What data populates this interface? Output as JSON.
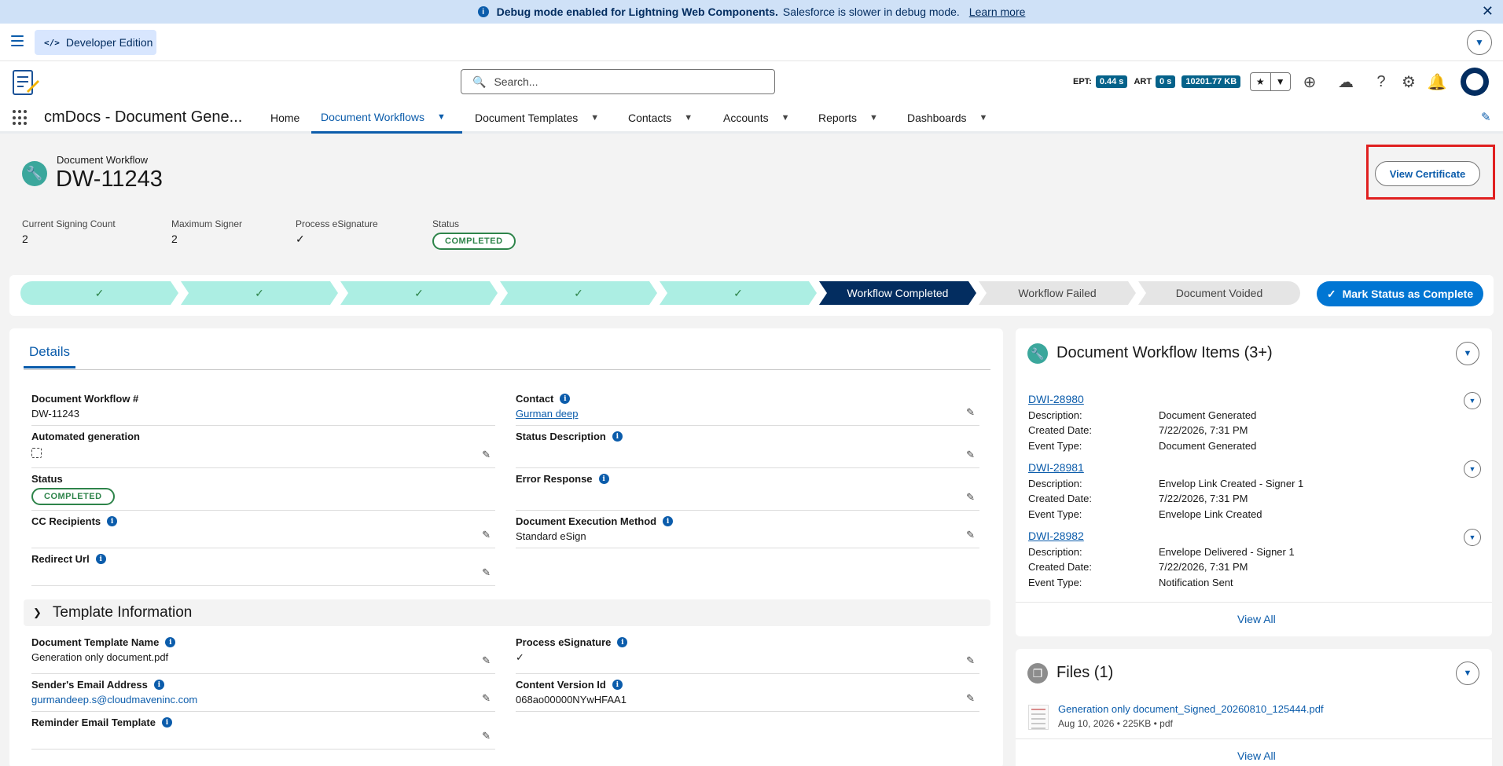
{
  "debug_banner": {
    "bold_text": "Debug mode enabled for Lightning Web Components.",
    "text": "Salesforce is slower in debug mode.",
    "link": "Learn more"
  },
  "utility": {
    "edition": "Developer Edition"
  },
  "header": {
    "search_placeholder": "Search...",
    "metrics": [
      {
        "label": "EPT:",
        "value": "0.44 s"
      },
      {
        "label": "ART",
        "value": "0 s"
      },
      {
        "label": "",
        "value": "10201.77 KB"
      }
    ]
  },
  "nav": {
    "app_name": "cmDocs - Document Gene...",
    "items": [
      {
        "label": "Home",
        "has_menu": false
      },
      {
        "label": "Document Workflows",
        "has_menu": true,
        "active": true
      },
      {
        "label": "Document Templates",
        "has_menu": true
      },
      {
        "label": "Contacts",
        "has_menu": true
      },
      {
        "label": "Accounts",
        "has_menu": true
      },
      {
        "label": "Reports",
        "has_menu": true
      },
      {
        "label": "Dashboards",
        "has_menu": true
      }
    ]
  },
  "record": {
    "object_type": "Document Workflow",
    "name": "DW-11243",
    "action_button": "View Certificate",
    "highlights": [
      {
        "label": "Current Signing Count",
        "value": "2"
      },
      {
        "label": "Maximum Signer",
        "value": "2"
      },
      {
        "label": "Process eSignature",
        "value": "✓"
      },
      {
        "label": "Status",
        "value": "COMPLETED"
      }
    ]
  },
  "path": {
    "stages": [
      {
        "label": "✓",
        "state": "done"
      },
      {
        "label": "✓",
        "state": "done"
      },
      {
        "label": "✓",
        "state": "done"
      },
      {
        "label": "✓",
        "state": "done"
      },
      {
        "label": "✓",
        "state": "done"
      },
      {
        "label": "Workflow Completed",
        "state": "current"
      },
      {
        "label": "Workflow Failed",
        "state": "future"
      },
      {
        "label": "Document Voided",
        "state": "future"
      }
    ],
    "mark_button": "Mark Status as Complete"
  },
  "details": {
    "tab_label": "Details",
    "fields": {
      "dw_number": {
        "label": "Document Workflow #",
        "value": "DW-11243"
      },
      "contact": {
        "label": "Contact",
        "value": "Gurman deep"
      },
      "automated_generation": {
        "label": "Automated generation",
        "value": ""
      },
      "status_description": {
        "label": "Status Description",
        "value": ""
      },
      "status": {
        "label": "Status",
        "value": "COMPLETED"
      },
      "error_response": {
        "label": "Error Response",
        "value": ""
      },
      "cc_recipients": {
        "label": "CC Recipients",
        "value": ""
      },
      "execution_method": {
        "label": "Document Execution Method",
        "value": "Standard eSign"
      },
      "redirect_url": {
        "label": "Redirect Url",
        "value": ""
      }
    },
    "template_section": {
      "title": "Template Information",
      "fields": {
        "template_name": {
          "label": "Document Template Name",
          "value": "Generation only document.pdf"
        },
        "process_esig": {
          "label": "Process eSignature",
          "value": "✓"
        },
        "sender_email": {
          "label": "Sender's Email Address",
          "value": "gurmandeep.s@cloudmaveninc.com"
        },
        "content_version": {
          "label": "Content Version Id",
          "value": "068ao00000NYwHFAA1"
        },
        "reminder_template": {
          "label": "Reminder Email Template",
          "value": ""
        }
      }
    }
  },
  "workflow_items": {
    "title": "Document Workflow Items (3+)",
    "items": [
      {
        "id": "DWI-28980",
        "description": "Document Generated",
        "created": "7/22/2026, 7:31 PM",
        "event": "Document Generated"
      },
      {
        "id": "DWI-28981",
        "description": "Envelop Link Created - Signer 1",
        "created": "7/22/2026, 7:31 PM",
        "event": "Envelope Link Created"
      },
      {
        "id": "DWI-28982",
        "description": "Envelope Delivered - Signer 1",
        "created": "7/22/2026, 7:31 PM",
        "event": "Notification Sent"
      }
    ],
    "labels": {
      "description": "Description:",
      "created": "Created Date:",
      "event": "Event Type:"
    },
    "view_all": "View All"
  },
  "files": {
    "title": "Files (1)",
    "file_name": "Generation only document_Signed_20260810_125444.pdf",
    "file_meta": "Aug 10, 2026 • 225KB • pdf",
    "view_all": "View All"
  },
  "colors": {
    "brand": "#0176d3",
    "path_done": "#aceee3",
    "path_current": "#032d60",
    "success": "#2e844a",
    "highlight_box": "#e02020",
    "record_icon": "#3ba79c"
  }
}
